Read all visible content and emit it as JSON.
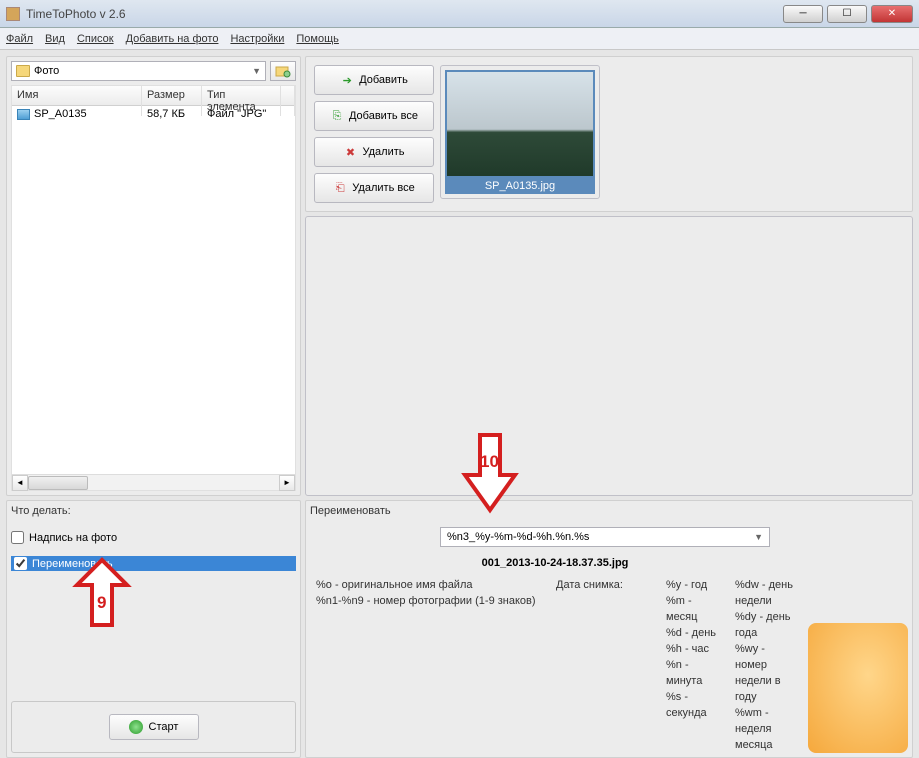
{
  "window": {
    "title": "TimeToPhoto v 2.6"
  },
  "menu": [
    "Файл",
    "Вид",
    "Список",
    "Добавить на фото",
    "Настройки",
    "Помощь"
  ],
  "folderbar": {
    "current": "Фото"
  },
  "filelist": {
    "headers": {
      "name": "Имя",
      "size": "Размер",
      "type": "Тип элемента"
    },
    "rows": [
      {
        "name": "SP_A0135",
        "size": "58,7 КБ",
        "type": "Файл \"JPG\""
      }
    ]
  },
  "buttons": {
    "add": "Добавить",
    "addall": "Добавить все",
    "delete": "Удалить",
    "deleteall": "Удалить все"
  },
  "thumbnail": {
    "caption": "SP_A0135.jpg"
  },
  "actions": {
    "title": "Что делать:",
    "cb_overlay": "Надпись на фото",
    "cb_rename": "Переименовать",
    "start": "Старт"
  },
  "rename": {
    "title": "Переименовать",
    "pattern": "%n3_%y-%m-%d-%h.%n.%s",
    "preview": "001_2013-10-24-18.37.35.jpg",
    "col1a": "%o - оригинальное имя файла",
    "col1b": "%n1-%n9 - номер фотографии (1-9 знаков)",
    "col2": "Дата снимка:",
    "col3": {
      "y": "%y - год",
      "m": "%m - месяц",
      "d": "%d - день",
      "h": "%h - час",
      "n": "%n - минута",
      "s": "%s - секунда"
    },
    "col4": {
      "dw": "%dw - день недели",
      "dy": "%dy - день года",
      "wy": "%wy - номер недели в году",
      "wm": "%wm - неделя месяца"
    }
  },
  "annotations": {
    "a9": "9",
    "a10": "10"
  }
}
